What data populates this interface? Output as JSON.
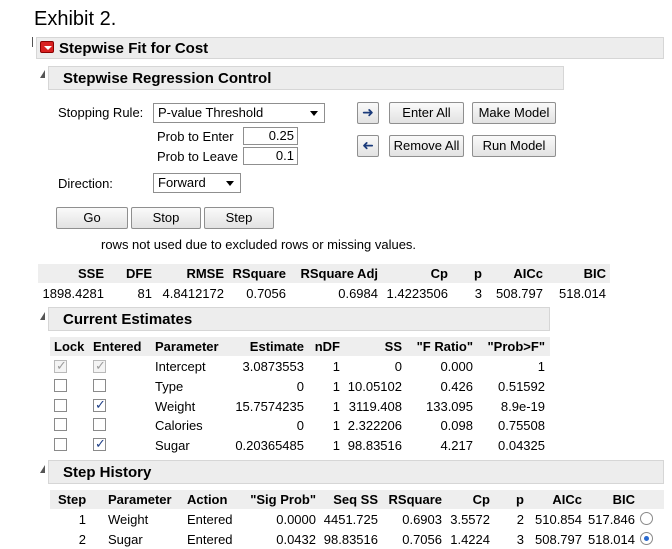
{
  "exhibit_title": "Exhibit 2.",
  "main_title": "Stepwise Fit for Cost",
  "control": {
    "title": "Stepwise Regression Control",
    "stopping_rule_label": "Stopping Rule:",
    "stopping_rule_value": "P-value Threshold",
    "prob_enter_label": "Prob to Enter",
    "prob_enter_value": "0.25",
    "prob_leave_label": "Prob to Leave",
    "prob_leave_value": "0.1",
    "direction_label": "Direction:",
    "direction_value": "Forward",
    "enter_all": "Enter All",
    "make_model": "Make Model",
    "remove_all": "Remove All",
    "run_model": "Run Model",
    "go": "Go",
    "stop": "Stop",
    "step": "Step",
    "note": "rows not used due to excluded rows or missing values."
  },
  "summary": {
    "headers": [
      "SSE",
      "DFE",
      "RMSE",
      "RSquare",
      "RSquare Adj",
      "Cp",
      "p",
      "AICc",
      "BIC"
    ],
    "values": [
      "1898.4281",
      "81",
      "4.8412172",
      "0.7056",
      "0.6984",
      "1.4223506",
      "3",
      "508.797",
      "518.014"
    ]
  },
  "estimates": {
    "title": "Current Estimates",
    "headers": [
      "Lock",
      "Entered",
      "Parameter",
      "Estimate",
      "nDF",
      "SS",
      "\"F Ratio\"",
      "\"Prob>F\""
    ],
    "rows": [
      {
        "lock": true,
        "lock_disabled": true,
        "entered": true,
        "entered_disabled": true,
        "parameter": "Intercept",
        "estimate": "3.0873553",
        "ndf": "1",
        "ss": "0",
        "fratio": "0.000",
        "prob": "1"
      },
      {
        "lock": false,
        "lock_disabled": false,
        "entered": false,
        "entered_disabled": false,
        "parameter": "Type",
        "estimate": "0",
        "ndf": "1",
        "ss": "10.05102",
        "fratio": "0.426",
        "prob": "0.51592"
      },
      {
        "lock": false,
        "lock_disabled": false,
        "entered": true,
        "entered_disabled": false,
        "parameter": "Weight",
        "estimate": "15.7574235",
        "ndf": "1",
        "ss": "3119.408",
        "fratio": "133.095",
        "prob": "8.9e-19"
      },
      {
        "lock": false,
        "lock_disabled": false,
        "entered": false,
        "entered_disabled": false,
        "parameter": "Calories",
        "estimate": "0",
        "ndf": "1",
        "ss": "2.322206",
        "fratio": "0.098",
        "prob": "0.75508"
      },
      {
        "lock": false,
        "lock_disabled": false,
        "entered": true,
        "entered_disabled": false,
        "parameter": "Sugar",
        "estimate": "0.20365485",
        "ndf": "1",
        "ss": "98.83516",
        "fratio": "4.217",
        "prob": "0.04325"
      }
    ]
  },
  "history": {
    "title": "Step History",
    "headers": [
      "Step",
      "Parameter",
      "Action",
      "\"Sig Prob\"",
      "Seq SS",
      "RSquare",
      "Cp",
      "p",
      "AICc",
      "BIC"
    ],
    "rows": [
      {
        "step": "1",
        "parameter": "Weight",
        "action": "Entered",
        "sig": "0.0000",
        "seqss": "4451.725",
        "rsq": "0.6903",
        "cp": "3.5572",
        "p": "2",
        "aicc": "510.854",
        "bic": "517.846",
        "selected": false
      },
      {
        "step": "2",
        "parameter": "Sugar",
        "action": "Entered",
        "sig": "0.0432",
        "seqss": "98.83516",
        "rsq": "0.7056",
        "cp": "1.4224",
        "p": "3",
        "aicc": "508.797",
        "bic": "518.014",
        "selected": true
      }
    ]
  }
}
